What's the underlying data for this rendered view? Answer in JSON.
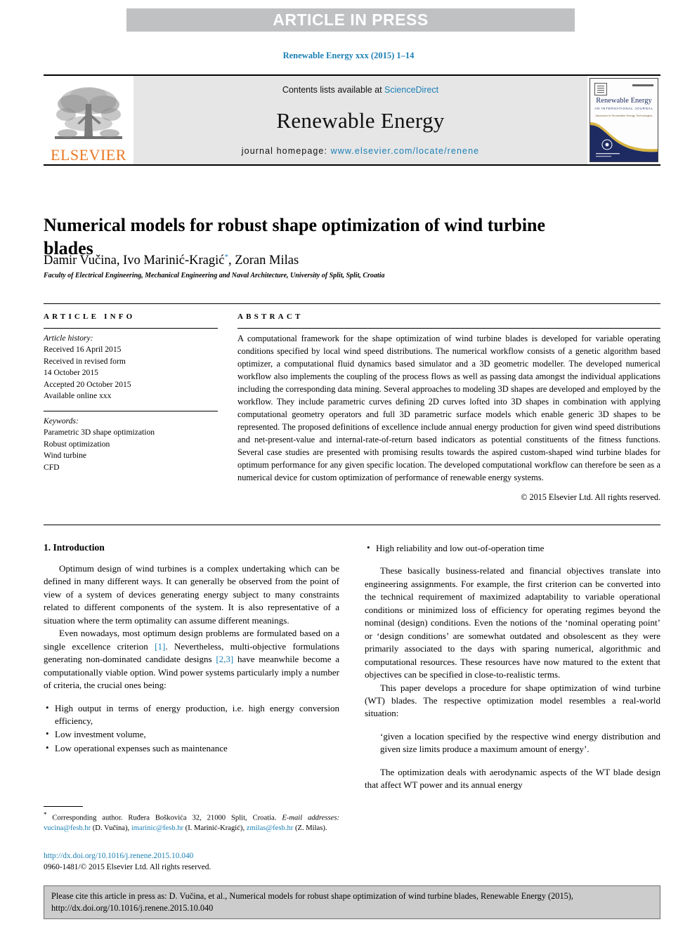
{
  "banner": {
    "label": "ARTICLE IN PRESS"
  },
  "journal_ref": "Renewable Energy xxx (2015) 1–14",
  "masthead": {
    "publisher_name": "ELSEVIER",
    "contents_prefix": "Contents lists available at ",
    "contents_link": "ScienceDirect",
    "journal_title": "Renewable Energy",
    "homepage_prefix": "journal homepage: ",
    "homepage_url": "www.elsevier.com/locate/renene",
    "cover": {
      "title": "Renewable Energy",
      "subtitle": "AN INTERNATIONAL JOURNAL",
      "subtitle2": "Advances in Renewable Energy Technologies"
    }
  },
  "article": {
    "title": "Numerical models for robust shape optimization of wind turbine blades",
    "authors": "Damir Vučina, Ivo Marinić-Kragić",
    "author_mark": "*",
    "authors_tail": ", Zoran Milas",
    "affiliation": "Faculty of Electrical Engineering, Mechanical Engineering and Naval Architecture, University of Split, Split, Croatia"
  },
  "article_info": {
    "heading": "ARTICLE INFO",
    "history_label": "Article history:",
    "history": [
      "Received 16 April 2015",
      "Received in revised form",
      "14 October 2015",
      "Accepted 20 October 2015",
      "Available online xxx"
    ],
    "keywords_label": "Keywords:",
    "keywords": [
      "Parametric 3D shape optimization",
      "Robust optimization",
      "Wind turbine",
      "CFD"
    ]
  },
  "abstract": {
    "heading": "ABSTRACT",
    "text": "A computational framework for the shape optimization of wind turbine blades is developed for variable operating conditions specified by local wind speed distributions. The numerical workflow consists of a genetic algorithm based optimizer, a computational fluid dynamics based simulator and a 3D geometric modeller. The developed numerical workflow also implements the coupling of the process flows as well as passing data amongst the individual applications including the corresponding data mining. Several approaches to modeling 3D shapes are developed and employed by the workflow. They include parametric curves defining 2D curves lofted into 3D shapes in combination with applying computational geometry operators and full 3D parametric surface models which enable generic 3D shapes to be represented. The proposed definitions of excellence include annual energy production for given wind speed distributions and net-present-value and internal-rate-of-return based indicators as potential constituents of the fitness functions. Several case studies are presented with promising results towards the aspired custom-shaped wind turbine blades for optimum performance for any given specific location. The developed computational workflow can therefore be seen as a numerical device for custom optimization of performance of renewable energy systems.",
    "copyright": "© 2015 Elsevier Ltd. All rights reserved."
  },
  "intro": {
    "section_title": "1. Introduction",
    "p1": "Optimum design of wind turbines is a complex undertaking which can be defined in many different ways. It can generally be observed from the point of view of a system of devices generating energy subject to many constraints related to different components of the system. It is also representative of a situation where the term optimality can assume different meanings.",
    "p2_a": "Even nowadays, most optimum design problems are formulated based on a single excellence criterion ",
    "p2_ref1": "[1]",
    "p2_b": ". Nevertheless, multi-objective formulations generating non-dominated candidate designs ",
    "p2_ref2": "[2,3]",
    "p2_c": " have meanwhile become a computationally viable option. Wind power systems particularly imply a number of criteria, the crucial ones being:",
    "bullets_left": [
      "High output in terms of energy production, i.e. high energy conversion efficiency,",
      "Low investment volume,",
      "Low operational expenses such as maintenance"
    ],
    "bullets_right": [
      "High reliability and low out-of-operation time"
    ],
    "p3": "These basically business-related and financial objectives translate into engineering assignments. For example, the first criterion can be converted into the technical requirement of maximized adaptability to variable operational conditions or minimized loss of efficiency for operating regimes beyond the nominal (design) conditions. Even the notions of the ‘nominal operating point’ or ‘design conditions’ are somewhat outdated and obsolescent as they were primarily associated to the days with sparing numerical, algorithmic and computational resources. These resources have now matured to the extent that objectives can be specified in close-to-realistic terms.",
    "p4": "This paper develops a procedure for shape optimization of wind turbine (WT) blades. The respective optimization model resembles a real-world situation:",
    "quote": "‘given a location specified by the respective wind energy distribution and given size limits produce a maximum amount of energy’.",
    "p5": "The optimization deals with aerodynamic aspects of the WT blade design that affect WT power and its annual energy"
  },
  "footnote": {
    "star": "*",
    "corresponding": " Corresponding author. Ruđera Boškovića 32, 21000 Split, Croatia.",
    "email_label": "E-mail addresses:",
    "email1": "vucina@fesb.hr",
    "email1_name": " (D. Vučina), ",
    "email2": "imarinic@fesb.hr",
    "email2_name": " (I. Marinić-Kragić), ",
    "email3": "zmilas@fesb.hr",
    "email3_name": " (Z. Milas).",
    "doi": "http://dx.doi.org/10.1016/j.renene.2015.10.040",
    "issn": "0960-1481/© 2015 Elsevier Ltd. All rights reserved."
  },
  "cite_box": {
    "text": "Please cite this article in press as: D. Vučina, et al., Numerical models for robust shape optimization of wind turbine blades, Renewable Energy (2015), http://dx.doi.org/10.1016/j.renene.2015.10.040"
  },
  "colors": {
    "link": "#1a7fb5",
    "banner_bg": "#bfc1c3",
    "masthead_bg": "#e6e6e6",
    "cite_bg": "#cccccc",
    "elsevier_orange": "#E87722"
  }
}
